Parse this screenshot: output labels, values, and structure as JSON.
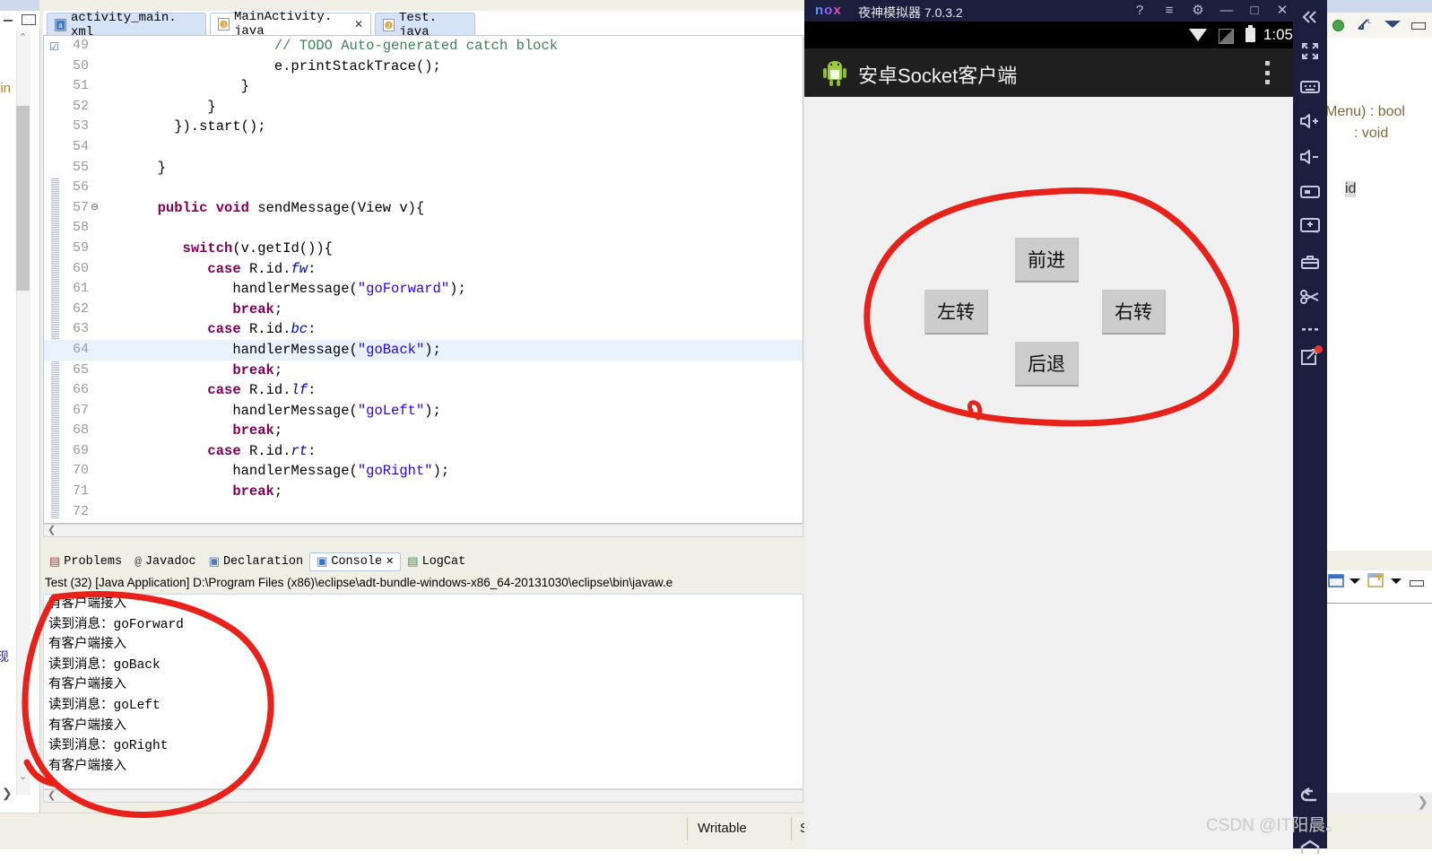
{
  "eclipse": {
    "editor_tabs": [
      {
        "label": "activity_main. xml",
        "icon": "xml-file-icon",
        "active": false,
        "closable": false
      },
      {
        "label": "MainActivity. java",
        "icon": "java-file-icon",
        "active": true,
        "closable": true
      },
      {
        "label": "Test. java",
        "icon": "java-file-icon",
        "active": false,
        "closable": false
      }
    ],
    "code_lines": [
      {
        "n": "49",
        "marker": "check",
        "fold": "",
        "html": "                <span class='cmt'>// TODO Auto-generated catch block</span>"
      },
      {
        "n": "50",
        "marker": "",
        "fold": "",
        "html": "                e.printStackTrace();"
      },
      {
        "n": "51",
        "marker": "",
        "fold": "",
        "html": "            }"
      },
      {
        "n": "52",
        "marker": "",
        "fold": "",
        "html": "        }"
      },
      {
        "n": "53",
        "marker": "",
        "fold": "",
        "html": "    }).start();"
      },
      {
        "n": "54",
        "marker": "",
        "fold": "",
        "html": ""
      },
      {
        "n": "55",
        "marker": "",
        "fold": "",
        "html": "  }"
      },
      {
        "n": "56",
        "marker": "",
        "fold": "",
        "html": ""
      },
      {
        "n": "57",
        "marker": "",
        "fold": "minus",
        "html": "  <span class='kw'>public</span> <span class='kw'>void</span> sendMessage(View v){"
      },
      {
        "n": "58",
        "marker": "",
        "fold": "",
        "html": ""
      },
      {
        "n": "59",
        "marker": "",
        "fold": "",
        "html": "     <span class='kw'>switch</span>(v.getId()){"
      },
      {
        "n": "60",
        "marker": "",
        "fold": "",
        "html": "        <span class='kw'>case</span> R.id.<span class='ital'>fw</span>:"
      },
      {
        "n": "61",
        "marker": "",
        "fold": "",
        "html": "           handlerMessage(<span class='str'>\"goForward\"</span>);"
      },
      {
        "n": "62",
        "marker": "",
        "fold": "",
        "html": "           <span class='kw'>break</span>;"
      },
      {
        "n": "63",
        "marker": "",
        "fold": "",
        "html": "        <span class='kw'>case</span> R.id.<span class='ital'>bc</span>:"
      },
      {
        "n": "64",
        "marker": "",
        "fold": "",
        "hl": true,
        "html": "           handlerMessage(<span class='str'>\"goBack\"</span>);"
      },
      {
        "n": "65",
        "marker": "",
        "fold": "",
        "html": "           <span class='kw'>break</span>;"
      },
      {
        "n": "66",
        "marker": "",
        "fold": "",
        "html": "        <span class='kw'>case</span> R.id.<span class='ital'>lf</span>:"
      },
      {
        "n": "67",
        "marker": "",
        "fold": "",
        "html": "           handlerMessage(<span class='str'>\"goLeft\"</span>);"
      },
      {
        "n": "68",
        "marker": "",
        "fold": "",
        "html": "           <span class='kw'>break</span>;"
      },
      {
        "n": "69",
        "marker": "",
        "fold": "",
        "html": "        <span class='kw'>case</span> R.id.<span class='ital'>rt</span>:"
      },
      {
        "n": "70",
        "marker": "",
        "fold": "",
        "html": "           handlerMessage(<span class='str'>\"goRight\"</span>);"
      },
      {
        "n": "71",
        "marker": "",
        "fold": "",
        "html": "           <span class='kw'>break</span>;"
      },
      {
        "n": "72",
        "marker": "",
        "fold": "",
        "html": ""
      }
    ],
    "console_tabs": [
      {
        "label": "Problems",
        "icon": "problems-icon",
        "selected": false
      },
      {
        "label": "Javadoc",
        "icon": "javadoc-icon",
        "selected": false
      },
      {
        "label": "Declaration",
        "icon": "declaration-icon",
        "selected": false
      },
      {
        "label": "Console",
        "icon": "console-icon",
        "selected": true
      },
      {
        "label": "LogCat",
        "icon": "logcat-icon",
        "selected": false
      }
    ],
    "console_header": "Test (32) [Java Application] D:\\Program Files (x86)\\eclipse\\adt-bundle-windows-x86_64-20131030\\eclipse\\bin\\javaw.e",
    "console_output": [
      "有客户端接入",
      "读到消息：goForward",
      "有客户端接入",
      "读到消息：goBack",
      "有客户端接入",
      "读到消息：goLeft",
      "有客户端接入",
      "读到消息：goRight",
      "有客户端接入"
    ],
    "statusbar": {
      "writable": "Writable",
      "next": "S"
    },
    "outline_rows": [
      "Menu) : bool",
      ": void",
      "id"
    ],
    "left_strip": {
      "fragment_top": "nin",
      "fragment_bottom": "现"
    }
  },
  "nox": {
    "titlebar": {
      "logo": "nox",
      "title": "夜神模拟器 7.0.3.2",
      "buttons": [
        {
          "name": "help-icon",
          "glyph": "?"
        },
        {
          "name": "menu-icon",
          "glyph": "≡"
        },
        {
          "name": "settings-gear-icon",
          "glyph": "⚙"
        },
        {
          "name": "minimize-icon",
          "glyph": "—"
        },
        {
          "name": "maximize-icon",
          "glyph": "□"
        },
        {
          "name": "close-icon",
          "glyph": "✕"
        }
      ]
    },
    "android_statusbar": {
      "time": "1:05",
      "icons": [
        "wifi-icon",
        "signal-icon",
        "battery-icon"
      ]
    },
    "app": {
      "title": "安卓Socket客户端",
      "icon": "android-robot-icon",
      "overflow": "overflow-menu-icon",
      "buttons": [
        {
          "label": "前进",
          "name": "forward-button"
        },
        {
          "label": "左转",
          "name": "turn-left-button"
        },
        {
          "label": "右转",
          "name": "turn-right-button"
        },
        {
          "label": "后退",
          "name": "back-button"
        }
      ]
    },
    "sidebar": [
      {
        "name": "collapse-icon",
        "glyph": "«"
      },
      {
        "name": "fullscreen-icon",
        "glyph": "⤢"
      },
      {
        "name": "keyboard-icon",
        "glyph": "⌨"
      },
      {
        "name": "volume-up-icon",
        "glyph": "🔊+"
      },
      {
        "name": "volume-down-icon",
        "glyph": "🔊−"
      },
      {
        "name": "screenshot-icon",
        "glyph": "▭"
      },
      {
        "name": "install-apk-icon",
        "glyph": "APK"
      },
      {
        "name": "toolbox-icon",
        "glyph": "🧰"
      },
      {
        "name": "scissors-icon",
        "glyph": "✂"
      },
      {
        "name": "more-icon",
        "glyph": "···"
      },
      {
        "name": "share-icon",
        "glyph": "↗",
        "badge": true
      },
      {
        "name": "back-nav-icon",
        "glyph": "↩"
      },
      {
        "name": "home-nav-icon",
        "glyph": "⌂"
      }
    ]
  },
  "watermark": "CSDN @IT阳晨。",
  "colors": {
    "nox_navy": "#1b1f3d",
    "android_bg": "#f0f0f0",
    "button_gray": "#cccccc",
    "annotation_red": "#e8221b",
    "eclipse_chrome": "#f0efe6",
    "code_keyword": "#7f0055",
    "code_string": "#2a00ff",
    "code_comment": "#3f7f5f"
  }
}
